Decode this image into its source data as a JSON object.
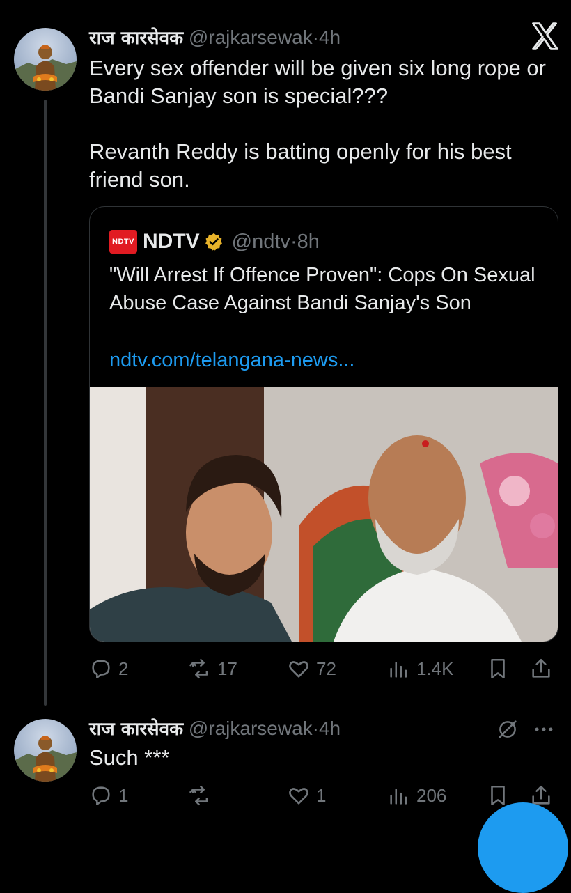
{
  "main_tweet": {
    "author_name": "राज कारसेवक",
    "handle": "@rajkarsewak",
    "separator": "·",
    "time": "4h",
    "text": "Every sex offender will be given six long rope or\nBandi Sanjay son is special???\n\nRevanth Reddy is batting openly for his best\nfriend son.",
    "quote": {
      "badge": "NDTV",
      "author_name": "NDTV",
      "handle": "@ndtv",
      "separator": "·",
      "time": "8h",
      "title": "\"Will Arrest If Offence Proven\": Cops On Sexual Abuse Case Against Bandi Sanjay's Son",
      "link": "ndtv.com/telangana-news..."
    },
    "stats": {
      "replies": "2",
      "reposts": "17",
      "likes": "72",
      "views": "1.4K"
    }
  },
  "reply_tweet": {
    "author_name": "राज कारसेवक",
    "handle": "@rajkarsewak",
    "separator": "·",
    "time": "4h",
    "text": "Such ***",
    "stats": {
      "replies": "1",
      "reposts": "",
      "likes": "1",
      "views": "206"
    }
  },
  "colors": {
    "accent": "#1d9bf0",
    "muted": "#71767b",
    "background": "#000000",
    "ndtv_red": "#e11b22",
    "verified_gold": "#e8b32a"
  },
  "icons": [
    "x-logo-icon",
    "verified-icon",
    "reply-icon",
    "repost-icon",
    "like-icon",
    "views-icon",
    "bookmark-icon",
    "share-icon",
    "grok-icon",
    "more-icon"
  ]
}
